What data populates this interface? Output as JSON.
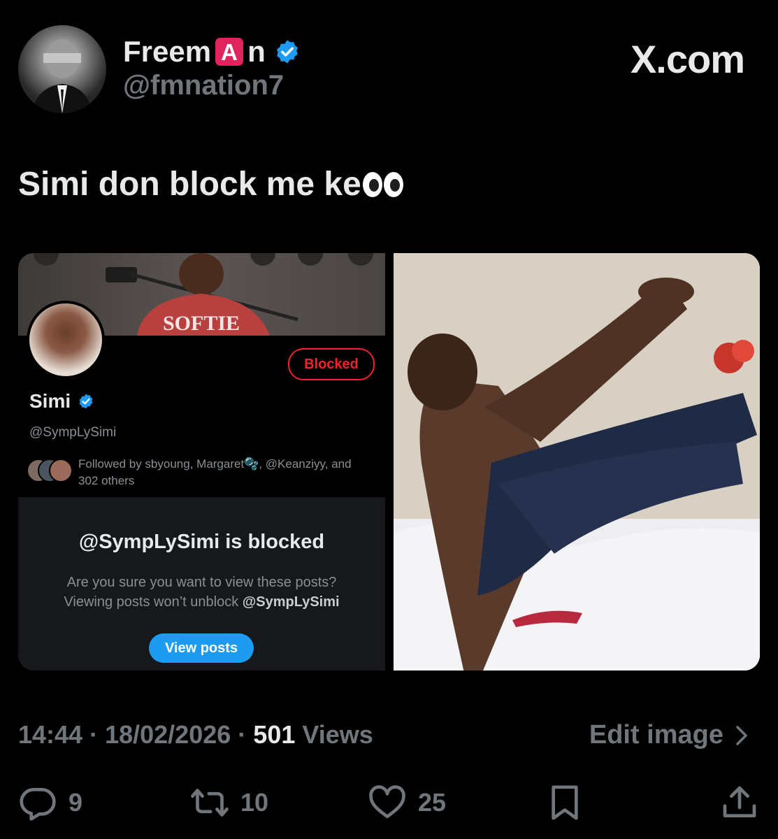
{
  "author": {
    "display_name_prefix": "Freem",
    "display_name_emoji": "A",
    "display_name_suffix": "n",
    "handle": "@fmnation7",
    "verified": true
  },
  "brand": "X.com",
  "tweet": {
    "text": "Simi don block me ke",
    "emoji": "eyes"
  },
  "media": {
    "profile_card": {
      "blocked_label": "Blocked",
      "name": "Simi",
      "handle": "@SympLySimi",
      "followed_by_line1": "Followed by sbyoung, Margaret🫧, @Keanziyy, and",
      "followed_by_line2": "302 others",
      "blocked_title": "@SympLySimi is blocked",
      "blocked_text_line1": "Are you sure you want to view these posts?",
      "blocked_text_line2_prefix": "Viewing posts won’t unblock ",
      "blocked_text_line2_handle": "@SympLySimi",
      "view_posts_label": "View posts"
    },
    "meme_image": "man-on-bed-reaction-photo"
  },
  "meta": {
    "time": "14:44",
    "date": "18/02/2026",
    "views_count": "501",
    "views_label": "Views",
    "edit_image_label": "Edit image"
  },
  "actions": {
    "replies": "9",
    "reposts": "10",
    "likes": "25"
  },
  "colors": {
    "background": "#000000",
    "text_primary": "#e7e9ea",
    "text_secondary": "#71767b",
    "accent_blue": "#1d9bf0",
    "blocked_red": "#f4212e"
  }
}
